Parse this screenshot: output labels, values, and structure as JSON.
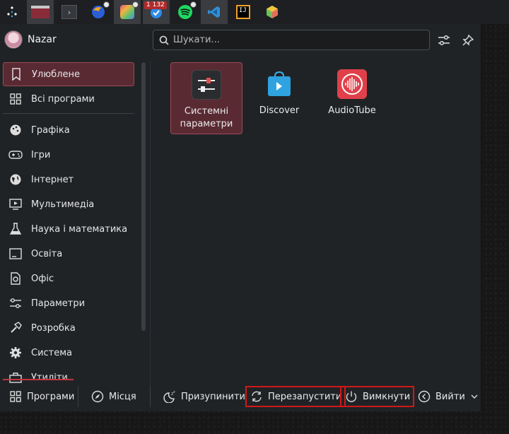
{
  "taskbar": {
    "items": [
      {
        "name": "app-launcher-icon"
      },
      {
        "name": "window-thumbnail-1"
      },
      {
        "name": "terminal-icon"
      },
      {
        "name": "firefox-icon"
      },
      {
        "name": "colors-app-icon"
      },
      {
        "name": "chat-app-icon",
        "count": "1 132"
      },
      {
        "name": "spotify-icon"
      },
      {
        "name": "vscode-icon"
      },
      {
        "name": "intellij-icon"
      },
      {
        "name": "cube-app-icon"
      }
    ]
  },
  "header": {
    "username": "Nazar",
    "search_placeholder": "Шукати..."
  },
  "sidebar": {
    "items": [
      {
        "label": "Улюблене",
        "icon": "bookmark-icon"
      },
      {
        "label": "Всі програми",
        "icon": "grid-icon"
      },
      {
        "label": "Графіка",
        "icon": "palette-icon"
      },
      {
        "label": "Ігри",
        "icon": "gamepad-icon"
      },
      {
        "label": "Інтернет",
        "icon": "globe-icon"
      },
      {
        "label": "Мультимедіа",
        "icon": "media-icon"
      },
      {
        "label": "Наука і математика",
        "icon": "flask-icon"
      },
      {
        "label": "Освіта",
        "icon": "education-icon"
      },
      {
        "label": "Офіс",
        "icon": "document-icon"
      },
      {
        "label": "Параметри",
        "icon": "sliders-icon"
      },
      {
        "label": "Розробка",
        "icon": "hammer-icon"
      },
      {
        "label": "Система",
        "icon": "gear-icon"
      },
      {
        "label": "Утиліти",
        "icon": "toolbox-icon"
      }
    ]
  },
  "favorites": [
    {
      "label": "Системні параметри",
      "icon": "system-settings-icon"
    },
    {
      "label": "Discover",
      "icon": "discover-icon"
    },
    {
      "label": "AudioTube",
      "icon": "audiotube-icon"
    }
  ],
  "footer": {
    "programs": "Програми",
    "places": "Місця",
    "sleep": "Призупинити",
    "restart": "Перезапустити",
    "shutdown": "Вимкнути",
    "logout": "Вийти"
  },
  "colors": {
    "accent": "#9c4a58",
    "highlight_outline": "#d01818"
  }
}
